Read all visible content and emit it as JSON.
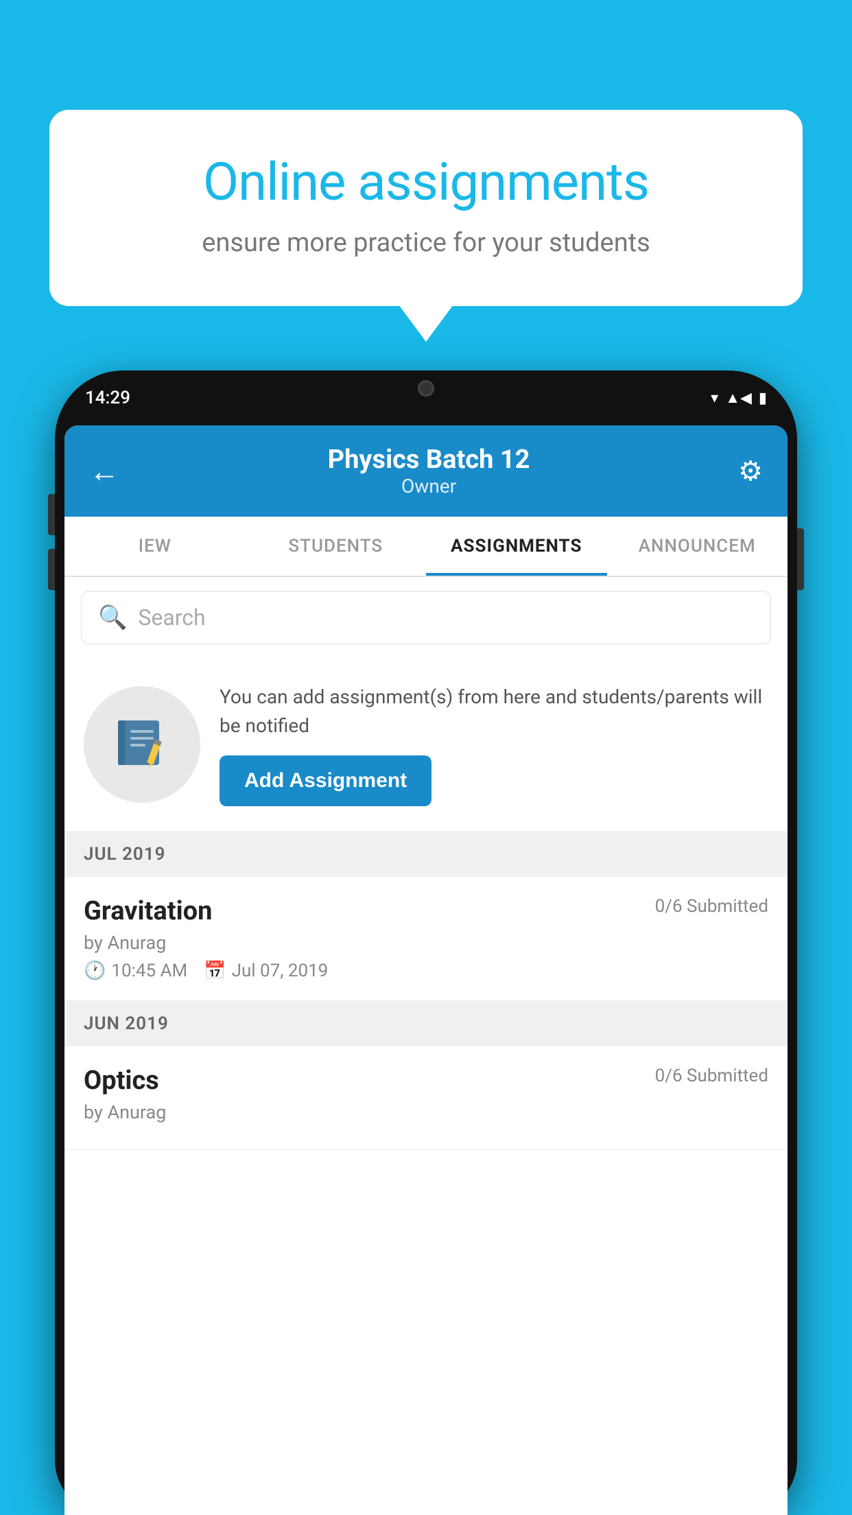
{
  "background_color": "#1ab8e8",
  "speech_bubble": {
    "title": "Online assignments",
    "subtitle": "ensure more practice for your students"
  },
  "phone": {
    "status_bar": {
      "time": "14:29",
      "icons": [
        "wifi",
        "signal",
        "battery"
      ]
    },
    "header": {
      "title": "Physics Batch 12",
      "subtitle": "Owner",
      "back_label": "←",
      "settings_label": "⚙"
    },
    "tabs": [
      {
        "label": "IEW",
        "active": false
      },
      {
        "label": "STUDENTS",
        "active": false
      },
      {
        "label": "ASSIGNMENTS",
        "active": true
      },
      {
        "label": "ANNOUNCEM",
        "active": false
      }
    ],
    "search": {
      "placeholder": "Search"
    },
    "promo": {
      "text": "You can add assignment(s) from here and students/parents will be notified",
      "button_label": "Add Assignment"
    },
    "sections": [
      {
        "month": "JUL 2019",
        "assignments": [
          {
            "title": "Gravitation",
            "submitted": "0/6 Submitted",
            "author": "by Anurag",
            "time": "10:45 AM",
            "date": "Jul 07, 2019"
          }
        ]
      },
      {
        "month": "JUN 2019",
        "assignments": [
          {
            "title": "Optics",
            "submitted": "0/6 Submitted",
            "author": "by Anurag",
            "time": "",
            "date": ""
          }
        ]
      }
    ]
  }
}
